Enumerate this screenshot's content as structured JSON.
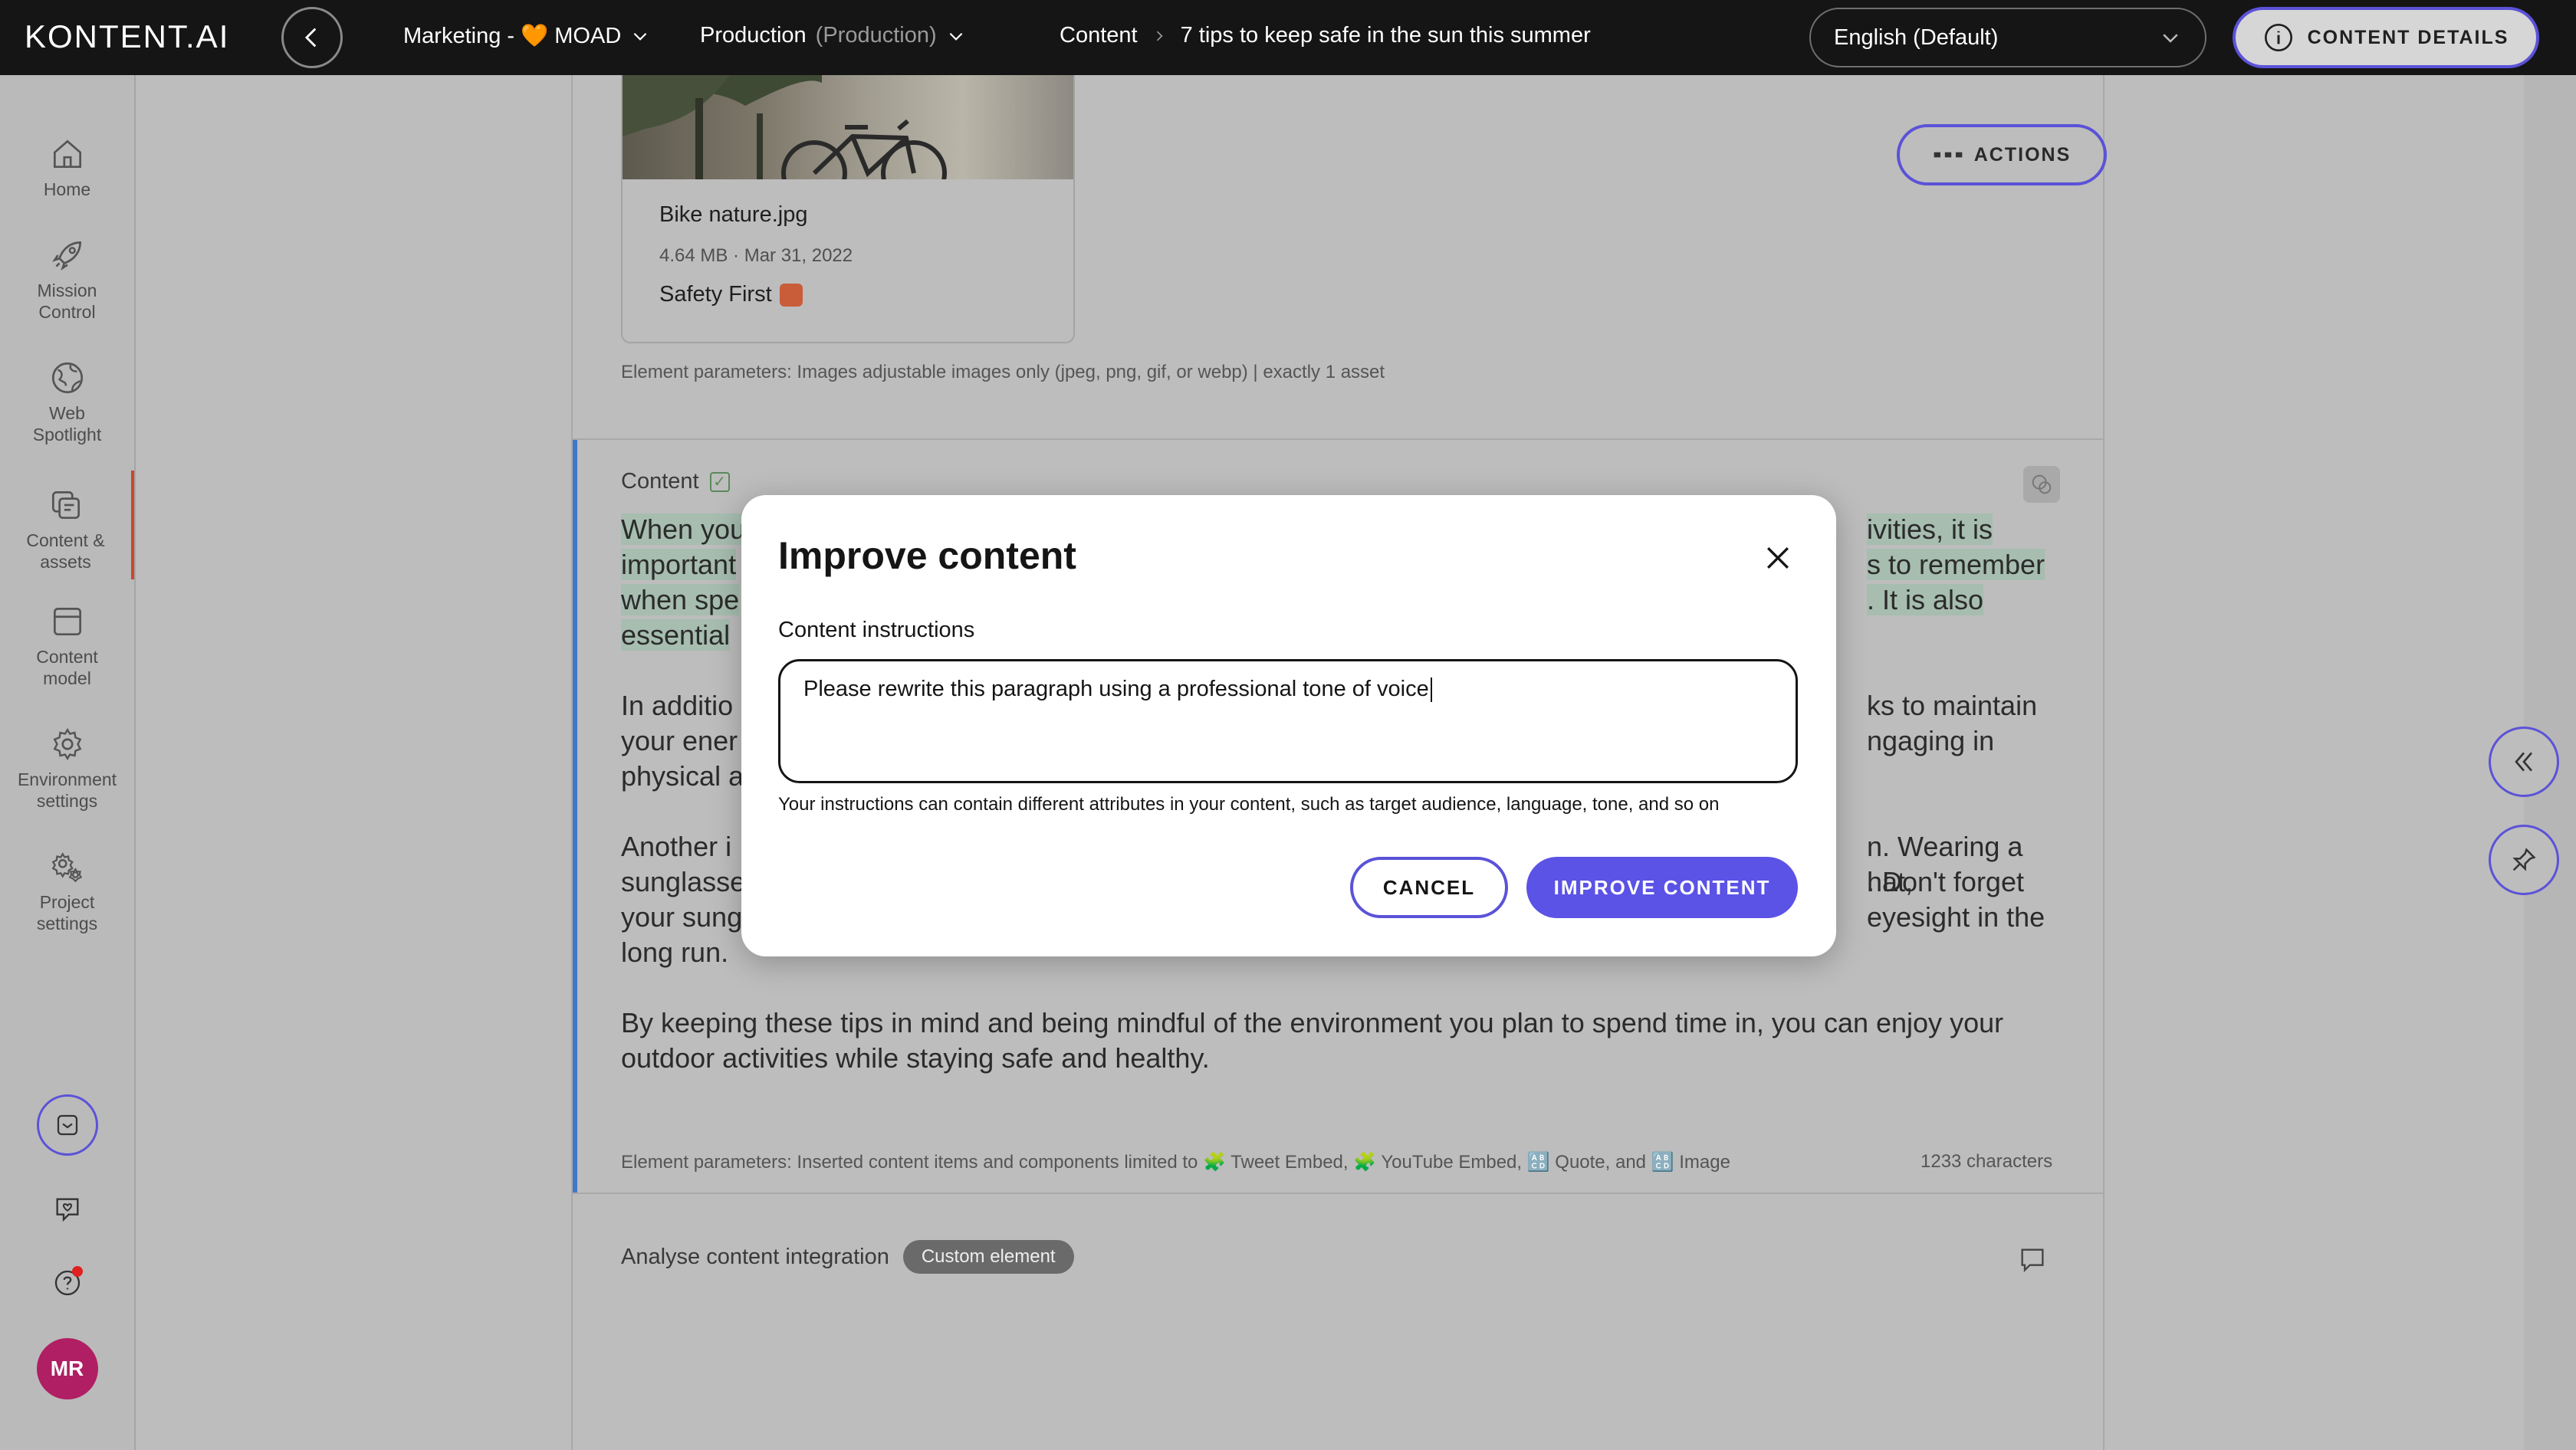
{
  "header": {
    "logo": "KONTENT.AI",
    "project": "Marketing - 🧡 MOAD",
    "environment": "Production",
    "environment_sub": "(Production)",
    "breadcrumb_section": "Content",
    "breadcrumb_item": "7 tips to keep safe in the sun this summer",
    "language": "English (Default)",
    "content_details": "CONTENT DETAILS"
  },
  "nav": {
    "items": [
      {
        "label": "Home",
        "icon": "home-icon"
      },
      {
        "label": "Mission Control",
        "icon": "rocket-icon"
      },
      {
        "label": "Web Spotlight",
        "icon": "globe-icon"
      },
      {
        "label": "Content & assets",
        "icon": "content-icon"
      },
      {
        "label": "Content model",
        "icon": "model-icon"
      },
      {
        "label": "Environment settings",
        "icon": "gear-icon"
      },
      {
        "label": "Project settings",
        "icon": "gears-icon"
      }
    ],
    "avatar": "MR"
  },
  "asset": {
    "name": "Bike nature.jpg",
    "meta": "4.64 MB · Mar 31, 2022",
    "description": "Safety First"
  },
  "actions_label": "ACTIONS",
  "asset_params": "Element parameters: Images adjustable images only (jpeg, png, gif, or webp) | exactly 1 asset",
  "content_element": {
    "title": "Content",
    "p1": [
      "When you",
      "ivities, it is",
      "important",
      "s to remember",
      "when spe",
      ". It is also",
      "essential"
    ],
    "p2": [
      "In additio",
      "ks to maintain",
      "your ener",
      "ngaging in",
      "physical a"
    ],
    "p3": [
      "Another i",
      "n. Wearing a hat,",
      "sunglasse",
      ". Don't forget",
      "your sung",
      "eyesight in the",
      "long run."
    ],
    "p4": "By keeping these tips in mind and being mindful of the environment you plan to spend time in, you can enjoy your outdoor activities while staying safe and healthy.",
    "params": "Element parameters: Inserted content items and components limited to 🧩 Tweet Embed, 🧩 YouTube Embed, 🔠 Quote, and 🔠 Image",
    "char_count": "1233 characters"
  },
  "custom_element": {
    "title": "Analyse content integration",
    "badge": "Custom element"
  },
  "modal": {
    "title": "Improve content",
    "field_label": "Content instructions",
    "field_value": "Please rewrite this paragraph using a professional tone of voice",
    "hint": "Your instructions can contain different attributes in your content, such as target audience, language, tone, and so on",
    "cancel": "CANCEL",
    "improve": "IMPROVE CONTENT"
  },
  "colors": {
    "accent": "#5b52e6",
    "topbar": "#151515",
    "active_nav": "#d0442c",
    "avatar": "#b01e63",
    "highlight": "#a6bdb0"
  }
}
